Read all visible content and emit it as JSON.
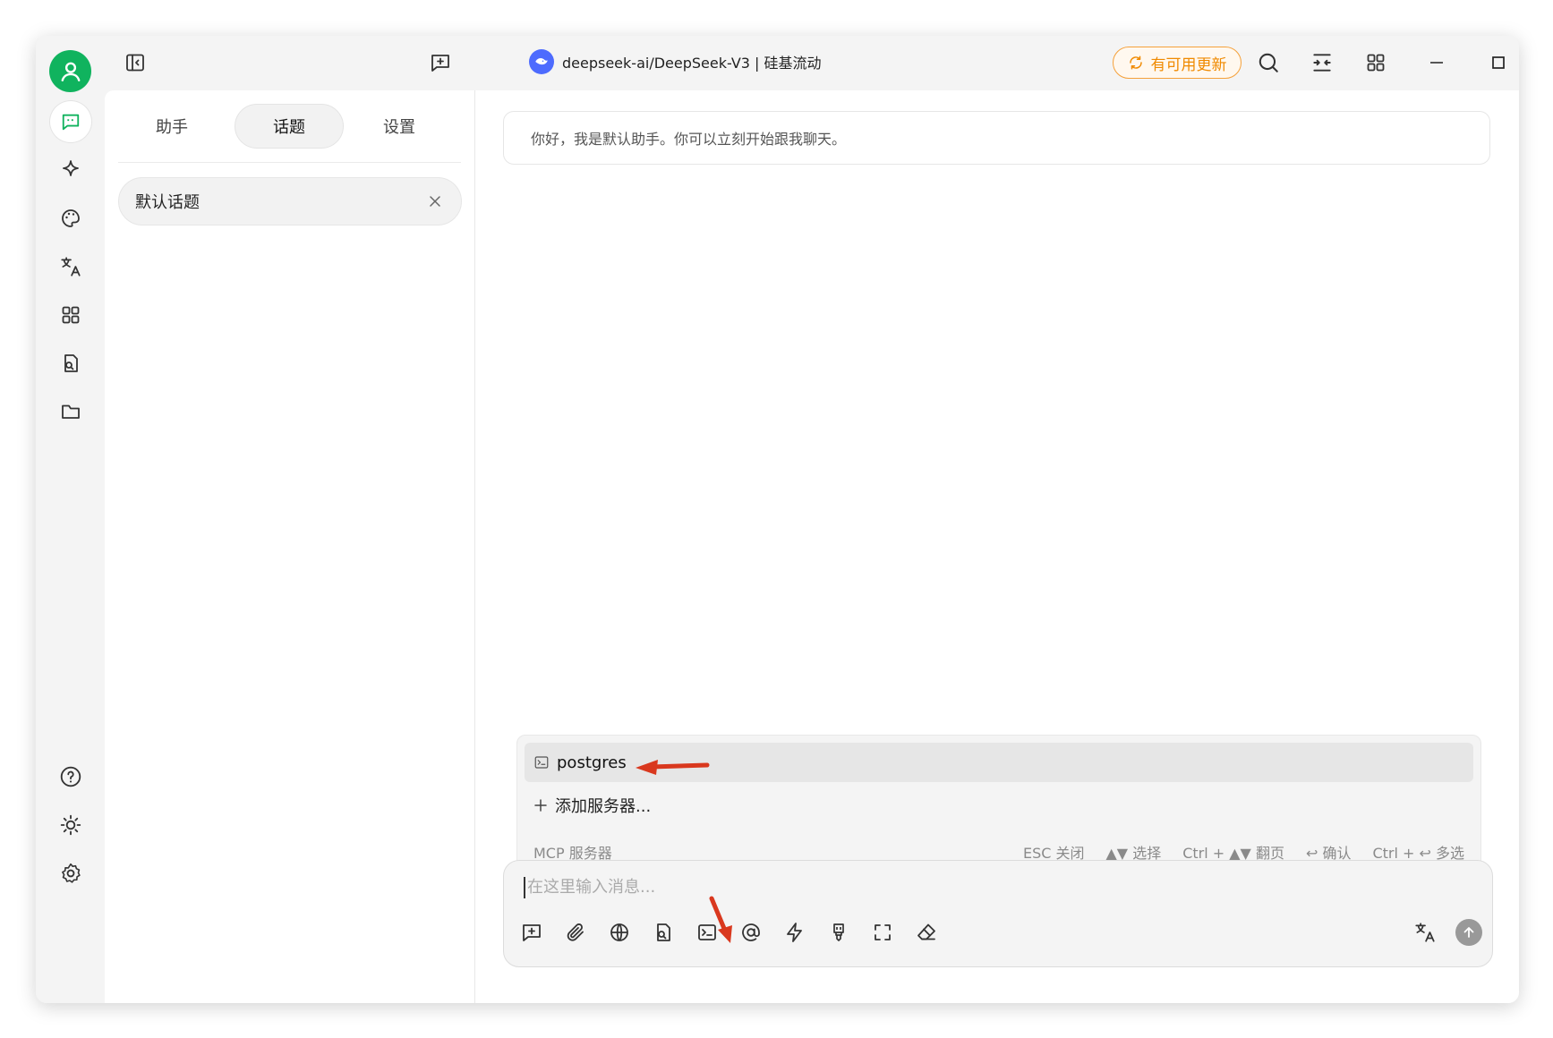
{
  "titlebar": {
    "model_title": "deepseek-ai/DeepSeek-V3 | 硅基流动",
    "update_label": "有可用更新"
  },
  "tabs": [
    {
      "label": "助手",
      "active": false
    },
    {
      "label": "话题",
      "active": true
    },
    {
      "label": "设置",
      "active": false
    }
  ],
  "topics": [
    {
      "label": "默认话题"
    }
  ],
  "chat": {
    "welcome": "你好，我是默认助手。你可以立刻开始跟我聊天。"
  },
  "mcp_popup": {
    "items": [
      {
        "label": "postgres",
        "icon": "terminal-icon"
      }
    ],
    "add_label": "添加服务器...",
    "footer_title": "MCP 服务器",
    "hints": [
      "ESC 关闭",
      "▲▼ 选择",
      "Ctrl + ▲▼ 翻页",
      "↩ 确认",
      "Ctrl + ↩ 多选"
    ]
  },
  "input": {
    "placeholder": "在这里输入消息..."
  },
  "colors": {
    "accent_green": "#10b35e",
    "update_orange": "#f08a00",
    "annotation_red": "#d9381e",
    "deepseek_blue": "#4d6bfe"
  },
  "rail_icons": [
    "chat-icon",
    "sparkle-icon",
    "palette-icon",
    "translate-icon",
    "apps-icon",
    "file-search-icon",
    "folder-icon",
    "help-icon",
    "sun-icon",
    "settings-icon"
  ],
  "toolbar_icons": [
    "new-topic-icon",
    "attachment-icon",
    "web-search-icon",
    "knowledge-base-icon",
    "mcp-terminal-icon",
    "mention-icon",
    "quick-phrase-icon",
    "clear-context-icon",
    "fullscreen-icon",
    "eraser-icon",
    "translate-icon",
    "send-icon"
  ]
}
